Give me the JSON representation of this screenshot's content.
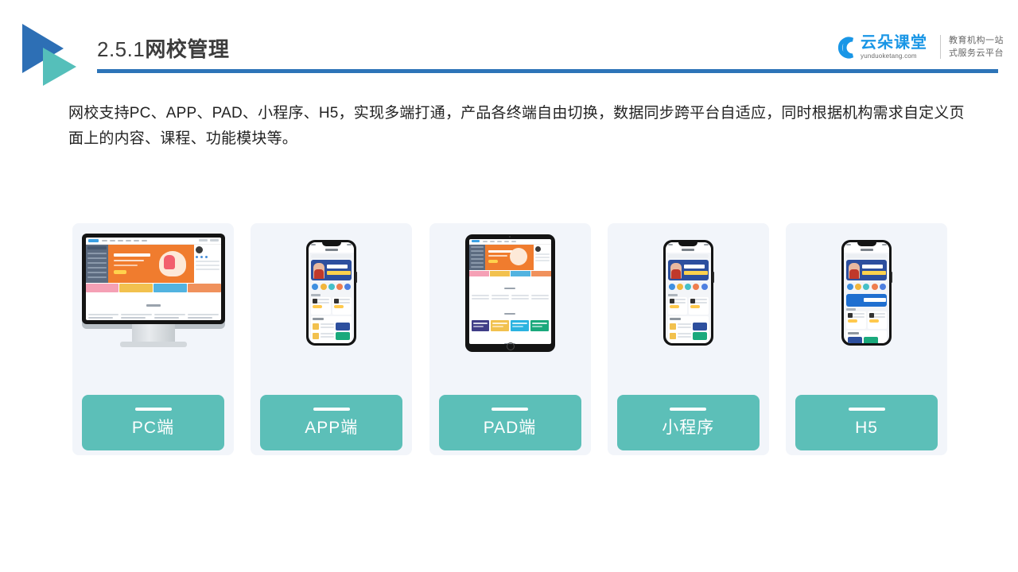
{
  "header": {
    "section_number": "2.5.1",
    "section_title": "网校管理",
    "logo_icon": "double-triangle-logo",
    "brand": {
      "icon": "cloud-icon",
      "name_cn": "云朵课堂",
      "name_en": "yunduoketang.com",
      "tagline_line1": "教育机构一站",
      "tagline_line2": "式服务云平台"
    },
    "rule_color": "#2d74b8"
  },
  "body": {
    "paragraph": "网校支持PC、APP、PAD、小程序、H5，实现多端打通，产品各终端自由切换，数据同步跨平台自适应，同时根据机构需求自定义页面上的内容、课程、功能模块等。"
  },
  "cards": [
    {
      "id": "pc",
      "label": "PC端",
      "device": "desktop-monitor"
    },
    {
      "id": "app",
      "label": "APP端",
      "device": "smartphone"
    },
    {
      "id": "pad",
      "label": "PAD端",
      "device": "tablet"
    },
    {
      "id": "mini",
      "label": "小程序",
      "device": "smartphone"
    },
    {
      "id": "h5",
      "label": "H5",
      "device": "smartphone"
    }
  ],
  "theme": {
    "label_bg": "#5cbfb8",
    "card_bg": "#f2f5fa",
    "accent_blue": "#2d74b8",
    "brand_blue": "#1996e6",
    "teal": "#55bfba",
    "text": "#232323"
  }
}
